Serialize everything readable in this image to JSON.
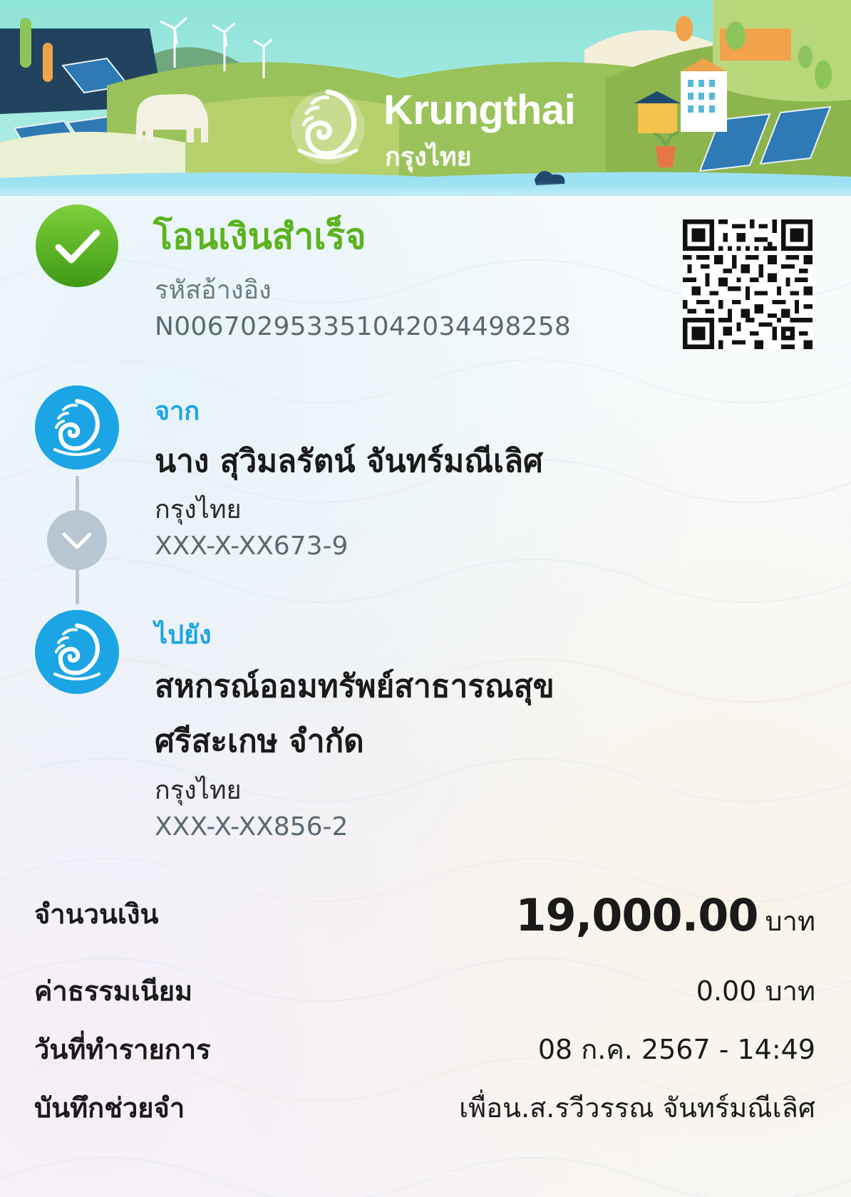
{
  "brand": {
    "name_en": "Krungthai",
    "name_th": "กรุงไทย"
  },
  "status": {
    "title": "โอนเงินสำเร็จ",
    "ref_label": "รหัสอ้างอิง",
    "ref_value": "N006702953351042034498258",
    "icon": "check-circle-icon",
    "color": "#5bb31f"
  },
  "from": {
    "label": "จาก",
    "name": "นาง สุวิมลรัตน์ จันทร์มณีเลิศ",
    "bank": "กรุงไทย",
    "account": "XXX-X-XX673-9"
  },
  "to": {
    "label": "ไปยัง",
    "name_line1": "สหกรณ์ออมทรัพย์สาธารณสุข",
    "name_line2": "ศรีสะเกษ จำกัด",
    "bank": "กรุงไทย",
    "account": "XXX-X-XX856-2"
  },
  "details": {
    "amount_label": "จำนวนเงิน",
    "amount_value": "19,000.00",
    "amount_unit": "บาท",
    "fee_label": "ค่าธรรมเนียม",
    "fee_value": "0.00 บาท",
    "date_label": "วันที่ทำรายการ",
    "date_value": "08 ก.ค. 2567 - 14:49",
    "memo_label": "บันทึกช่วยจำ",
    "memo_value": "เพื่อน.ส.รวีวรรณ จันทร์มณีเลิศ"
  },
  "colors": {
    "accent_blue": "#1ba5e4",
    "success_green": "#5bb31f",
    "connector_gray": "#b7c6d0"
  }
}
